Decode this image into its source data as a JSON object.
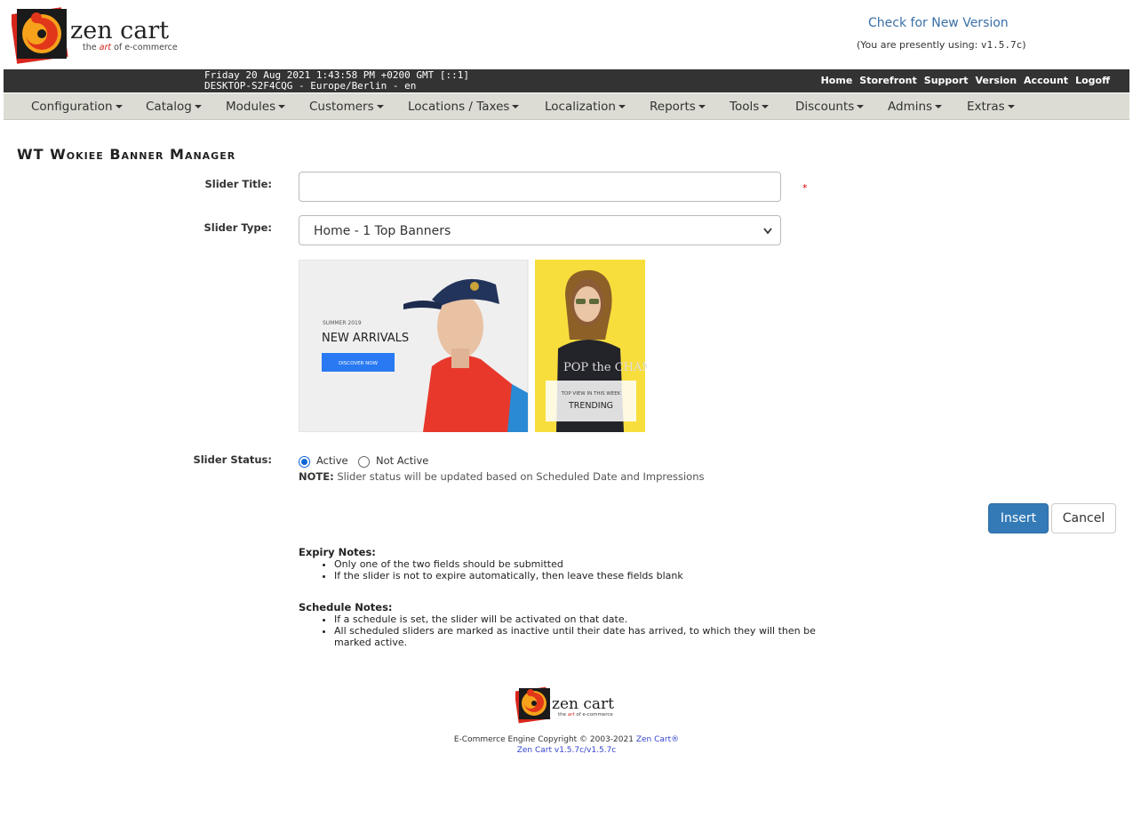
{
  "header": {
    "logo_word": "zen cart",
    "logo_tagline": "the art of e-commerce",
    "check_version": "Check for New Version",
    "using_prefix": "(You are presently using:",
    "using_version": "v1.5.7c",
    "using_suffix": ")"
  },
  "topbar": {
    "datetime": "Friday 20 Aug 2021 1:43:58 PM +0200 GMT [::1]",
    "host": "DESKTOP-S2F4CQG - Europe/Berlin - en",
    "links": [
      "Home",
      "Storefront",
      "Support",
      "Version",
      "Account",
      "Logoff"
    ]
  },
  "menu": [
    "Configuration",
    "Catalog",
    "Modules",
    "Customers",
    "Locations / Taxes",
    "Localization",
    "Reports",
    "Tools",
    "Discounts",
    "Admins",
    "Extras"
  ],
  "page": {
    "title": "WT Wokiee Banner Manager",
    "slider_title_label": "Slider Title:",
    "slider_title_value": "",
    "required_mark": "*",
    "slider_type_label": "Slider Type:",
    "slider_type_value": "Home - 1 Top Banners",
    "slider_status_label": "Slider Status:",
    "status_active": "Active",
    "status_not_active": "Not Active",
    "status_selected": "Active",
    "note_label": "NOTE:",
    "note_text": "Slider status will be updated based on Scheduled Date and Impressions",
    "insert_button": "Insert",
    "cancel_button": "Cancel"
  },
  "preview": {
    "banner1_small": "SUMMER 2019",
    "banner1_title": "NEW ARRIVALS",
    "banner1_button": "DISCOVER NOW",
    "banner2_small": "TOP VIEW IN THIS WEEK",
    "banner2_title": "TRENDING",
    "banner2_shirt": "POP the CHAM"
  },
  "expiry_notes": {
    "heading": "Expiry Notes:",
    "items": [
      "Only one of the two fields should be submitted",
      "If the slider is not to expire automatically, then leave these fields blank"
    ]
  },
  "schedule_notes": {
    "heading": "Schedule Notes:",
    "items": [
      "If a schedule is set, the slider will be activated on that date.",
      "All scheduled sliders are marked as inactive until their date has arrived, to which they will then be marked active."
    ]
  },
  "footer": {
    "copyright": "E-Commerce Engine Copyright © 2003-2021",
    "zen_link": "Zen Cart®",
    "version_link": "Zen Cart v1.5.7c/v1.5.7c"
  },
  "colors": {
    "topbar_bg": "#333333",
    "menubar_bg": "#dcdcd4",
    "link_blue": "#3a6fa8",
    "insert_bg": "#337ab7",
    "required_red": "#dd0000"
  }
}
